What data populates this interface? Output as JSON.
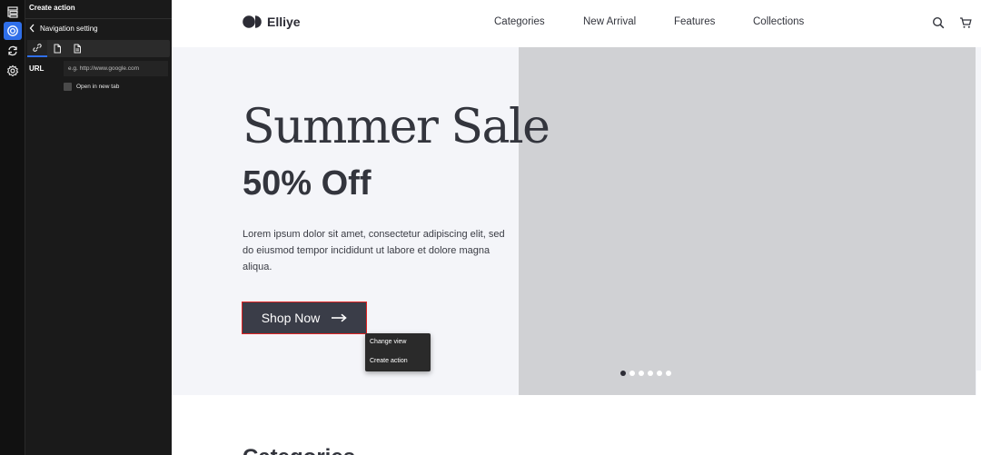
{
  "editor": {
    "title": "Create action",
    "back_label": "Navigation setting",
    "tabs": [
      {
        "icon": "link-icon"
      },
      {
        "icon": "page-icon"
      },
      {
        "icon": "file-icon"
      }
    ],
    "url_label": "URL",
    "url_value": "",
    "url_placeholder": "e.g. http://www.google.com",
    "new_tab_label": "Open in new tab",
    "new_tab_checked": false
  },
  "rail": {
    "items": [
      {
        "icon": "layers-icon"
      },
      {
        "icon": "target-icon",
        "active": true
      },
      {
        "icon": "sync-icon"
      },
      {
        "icon": "gear-icon"
      }
    ]
  },
  "site": {
    "brand": "Elliye",
    "nav": [
      "Categories",
      "New Arrival",
      "Features",
      "Collections"
    ],
    "hero": {
      "title": "Summer Sale",
      "subtitle": "50% Off",
      "description": "Lorem ipsum dolor sit amet, consectetur adipiscing elit, sed do eiusmod tempor incididunt ut labore et dolore magna aliqua.",
      "cta_label": "Shop Now",
      "slides": 6,
      "active_slide": 1
    },
    "next_section_heading": "Categories"
  },
  "context_menu": {
    "items": [
      "Change view",
      "Create action"
    ]
  },
  "colors": {
    "accent": "#2f6fe9",
    "selection_outline": "#e02424",
    "text_dark": "#33353d",
    "button_bg": "#3a3d48"
  }
}
